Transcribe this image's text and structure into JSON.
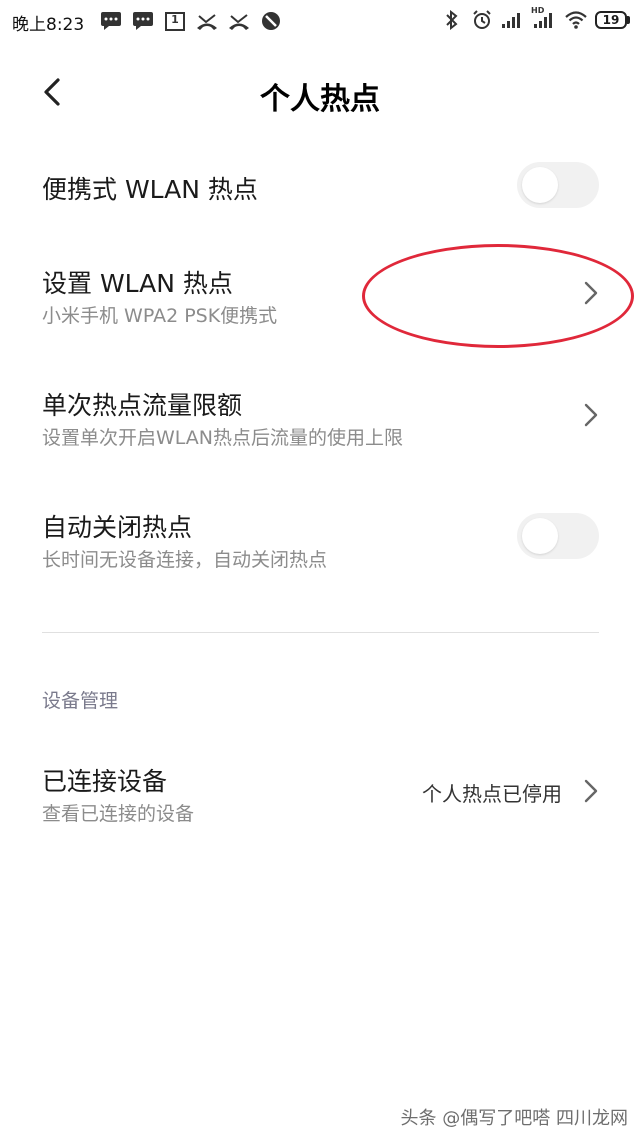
{
  "status_bar": {
    "time": "晚上8:23",
    "left_icons": [
      "message-icon",
      "message-icon",
      "calendar-icon",
      "missed-call-icon",
      "missed-call-icon",
      "do-not-disturb-icon"
    ],
    "calendar_day": "1",
    "network_type": "HD",
    "battery_level": "19"
  },
  "header": {
    "title": "个人热点"
  },
  "settings": {
    "portable_hotspot": {
      "title": "便携式 WLAN 热点",
      "enabled": false
    },
    "setup_hotspot": {
      "title": "设置 WLAN 热点",
      "subtitle": "小米手机 WPA2 PSK便携式"
    },
    "data_limit": {
      "title": "单次热点流量限额",
      "subtitle": "设置单次开启WLAN热点后流量的使用上限"
    },
    "auto_off": {
      "title": "自动关闭热点",
      "subtitle": "长时间无设备连接，自动关闭热点",
      "enabled": false
    }
  },
  "device_management": {
    "section_title": "设备管理",
    "connected_devices": {
      "title": "已连接设备",
      "subtitle": "查看已连接的设备",
      "value": "个人热点已停用"
    }
  },
  "annotation": {
    "color": "#e0283a"
  },
  "watermark": "头条 @偶写了吧嗒 四川龙网"
}
